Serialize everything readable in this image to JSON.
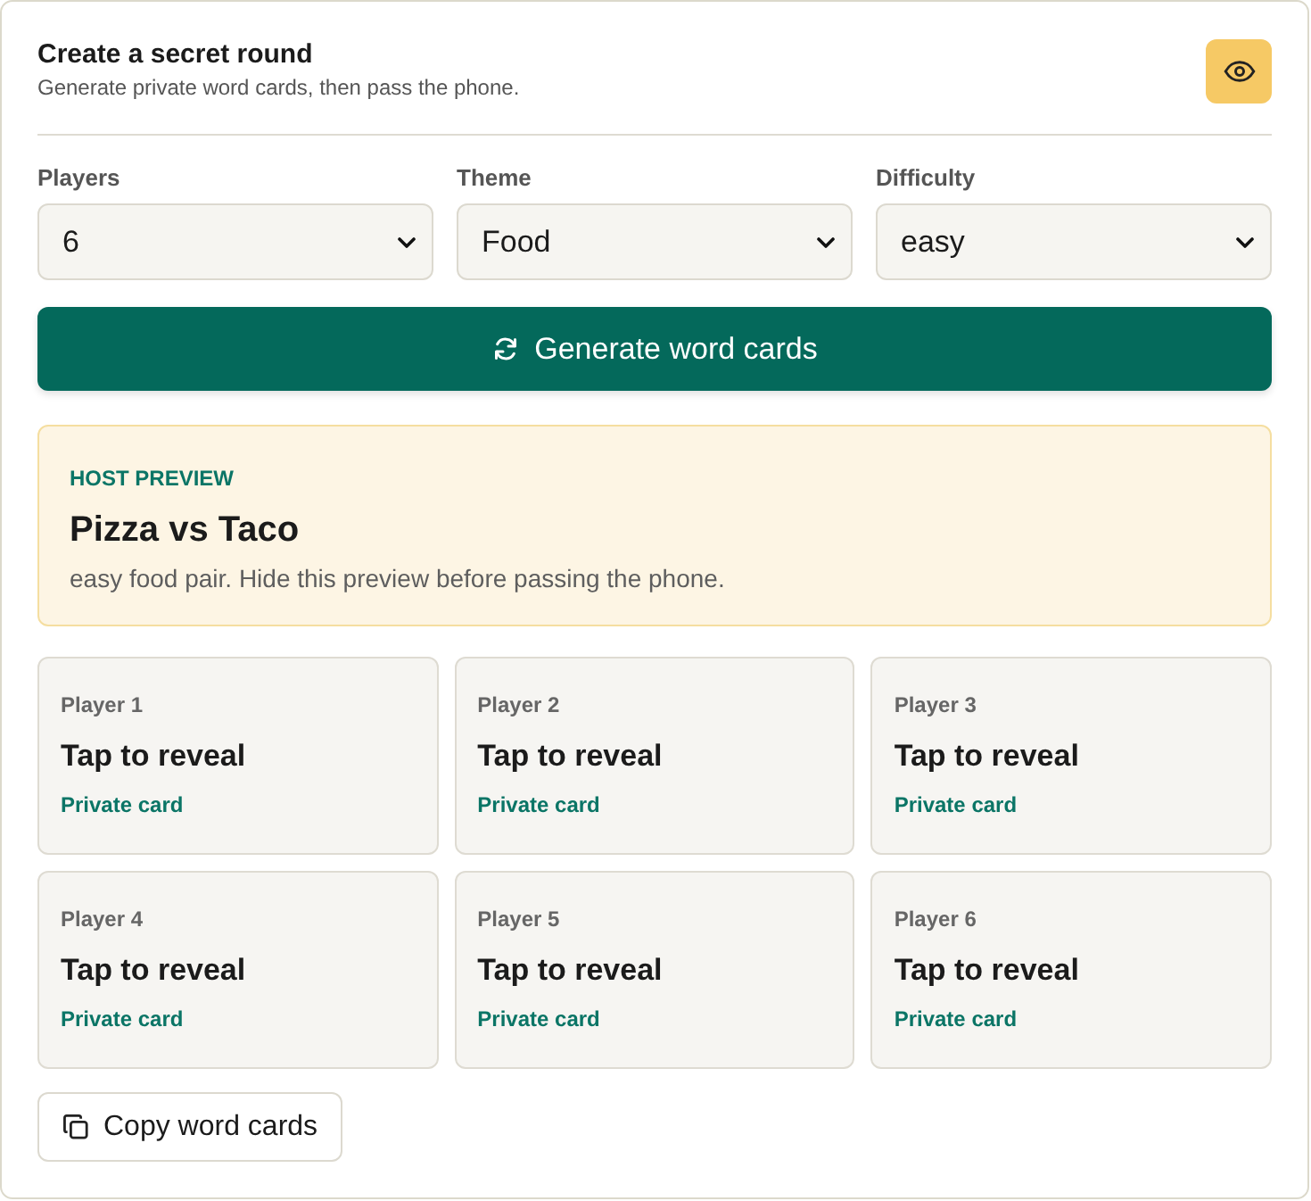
{
  "header": {
    "title": "Create a secret round",
    "subtitle": "Generate private word cards, then pass the phone.",
    "preview_toggle": {
      "on": true
    }
  },
  "fields": [
    {
      "label": "Players",
      "value": "6"
    },
    {
      "label": "Theme",
      "value": "Food"
    },
    {
      "label": "Difficulty",
      "value": "easy"
    }
  ],
  "generate_button": {
    "label": "Generate word cards"
  },
  "host_preview": {
    "eyebrow": "HOST PREVIEW",
    "title": "Pizza vs Taco",
    "note": "easy food pair. Hide this preview before passing the phone."
  },
  "cards": [
    {
      "player": "Player 1",
      "prompt": "Tap to reveal",
      "tag": "Private card"
    },
    {
      "player": "Player 2",
      "prompt": "Tap to reveal",
      "tag": "Private card"
    },
    {
      "player": "Player 3",
      "prompt": "Tap to reveal",
      "tag": "Private card"
    },
    {
      "player": "Player 4",
      "prompt": "Tap to reveal",
      "tag": "Private card"
    },
    {
      "player": "Player 5",
      "prompt": "Tap to reveal",
      "tag": "Private card"
    },
    {
      "player": "Player 6",
      "prompt": "Tap to reveal",
      "tag": "Private card"
    }
  ],
  "copy_button": {
    "label": "Copy word cards"
  }
}
